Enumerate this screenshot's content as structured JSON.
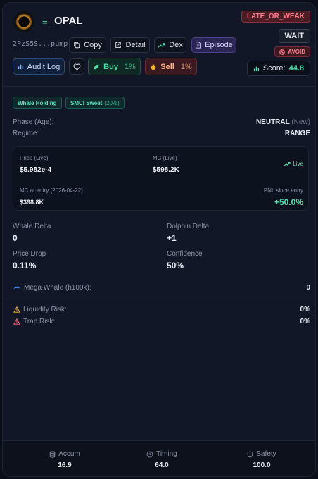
{
  "token": {
    "name": "OPAL",
    "address": "2PzS5S...pump",
    "logo_icon": "token-logo-icon"
  },
  "actions": {
    "copy_label": "Copy",
    "detail_label": "Detail",
    "dex_label": "Dex",
    "episode_label": "Episode",
    "audit_label": "Audit Log",
    "buy_label": "Buy",
    "buy_pct": "1%",
    "sell_label": "Sell",
    "sell_pct": "1%"
  },
  "badges": {
    "stage": "LATE_OR_WEAK",
    "decision": "WAIT",
    "avoid": "AVOID"
  },
  "score": {
    "label": "Score:",
    "value": "44.8"
  },
  "tags": [
    {
      "label": "Whale Holding",
      "suffix": ""
    },
    {
      "label": "SMCI Sweet",
      "suffix": "(20%)"
    }
  ],
  "phase": {
    "label": "Phase (Age):",
    "value": "NEUTRAL",
    "suffix": "(New)"
  },
  "regime": {
    "label": "Regime:",
    "value": "RANGE"
  },
  "live": {
    "price_label": "Price (Live)",
    "price_value": "$5.982e-4",
    "mc_label": "MC (Live)",
    "mc_value": "$598.2K",
    "live_label": "Live",
    "entry_label": "MC at entry (2026-04-22)",
    "entry_value": "$398.8K",
    "pnl_label": "PNL since entry",
    "pnl_value": "+50.0%"
  },
  "metrics": {
    "whale_delta_label": "Whale Delta",
    "whale_delta_value": "0",
    "dolphin_delta_label": "Dolphin Delta",
    "dolphin_delta_value": "+1",
    "price_drop_label": "Price Drop",
    "price_drop_value": "0.11%",
    "confidence_label": "Confidence",
    "confidence_value": "50%"
  },
  "risks": {
    "mega_whale_label": "Mega Whale (h100k):",
    "mega_whale_value": "0",
    "liquidity_label": "Liquidity Risk:",
    "liquidity_value": "0%",
    "trap_label": "Trap Risk:",
    "trap_value": "0%"
  },
  "footer": {
    "accum_label": "Accum",
    "accum_value": "16.9",
    "timing_label": "Timing",
    "timing_value": "64.0",
    "safety_label": "Safety",
    "safety_value": "100.0"
  },
  "colors": {
    "background": "#0b0f19",
    "card": "#111726",
    "accent_green": "#4ee0a8",
    "accent_red": "#ff6b7c",
    "warning": "#f0b432"
  }
}
